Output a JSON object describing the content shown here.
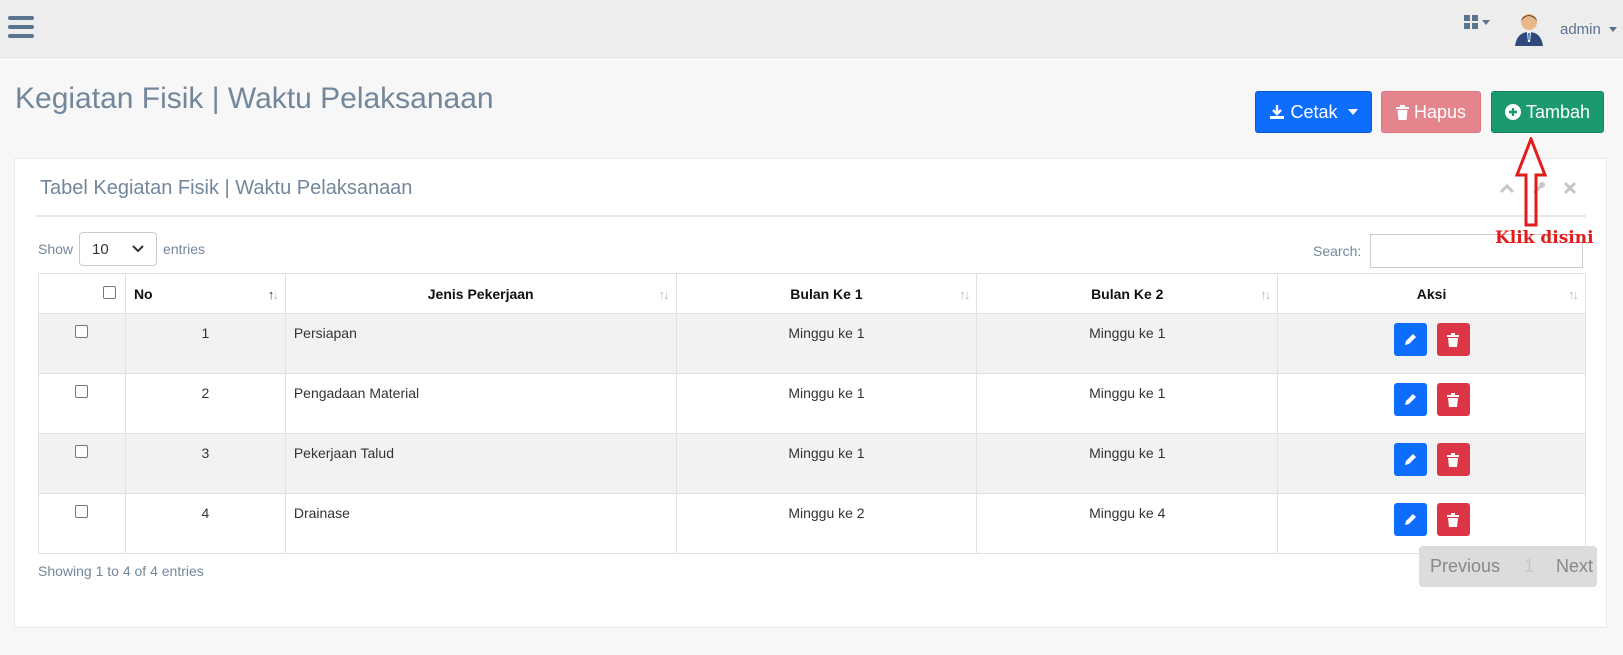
{
  "topbar": {
    "username": "admin"
  },
  "header": {
    "title": "Kegiatan Fisik | Waktu Pelaksanaan",
    "buttons": {
      "cetak": "Cetak",
      "hapus": "Hapus",
      "tambah": "Tambah"
    }
  },
  "panel": {
    "title": "Tabel Kegiatan Fisik | Waktu Pelaksanaan",
    "show_label": "Show",
    "entries_label": "entries",
    "page_length": "10",
    "search_label": "Search:",
    "search_value": ""
  },
  "table": {
    "columns": [
      "No",
      "Jenis Pekerjaan",
      "Bulan Ke 1",
      "Bulan Ke 2",
      "Aksi"
    ],
    "rows": [
      {
        "no": "1",
        "jenis": "Persiapan",
        "bulan1": "Minggu ke 1",
        "bulan2": "Minggu ke 1"
      },
      {
        "no": "2",
        "jenis": "Pengadaan Material",
        "bulan1": "Minggu ke 1",
        "bulan2": "Minggu ke 1"
      },
      {
        "no": "3",
        "jenis": "Pekerjaan Talud",
        "bulan1": "Minggu ke 1",
        "bulan2": "Minggu ke 1"
      },
      {
        "no": "4",
        "jenis": "Drainase",
        "bulan1": "Minggu ke 2",
        "bulan2": "Minggu ke 4"
      }
    ]
  },
  "footer": {
    "info": "Showing 1 to 4 of 4 entries",
    "previous": "Previous",
    "page": "1",
    "next": "Next"
  },
  "annotation": {
    "text": "Klik disini",
    "color": "#e21b1b"
  },
  "colors": {
    "primary": "#0d6efd",
    "danger": "#dc3545",
    "success": "#1a9a6e",
    "muted": "#73879c"
  }
}
